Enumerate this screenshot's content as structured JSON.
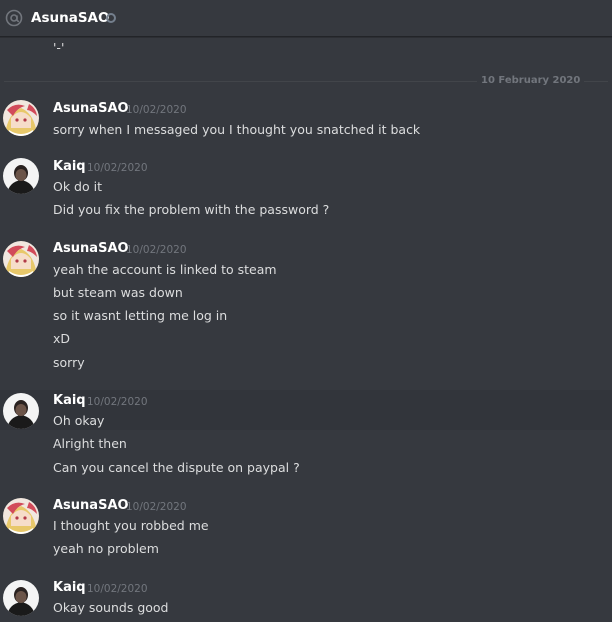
{
  "header": {
    "title": "AsunaSAO",
    "icon": "at-icon",
    "status_icon": "status-offline-icon"
  },
  "previous_message": {
    "text": "'-'"
  },
  "divider": {
    "label": "10 February 2020"
  },
  "groups": [
    {
      "author": "AsunaSAO",
      "timestamp": "10/02/2020",
      "avatar": "asuna-avatar",
      "lines": [
        "sorry when I messaged you I thought you snatched it back"
      ]
    },
    {
      "author": "Kaiq",
      "timestamp": "10/02/2020",
      "avatar": "kaiq-avatar",
      "lines": [
        "Ok do it",
        "Did you fix the problem with the password ?"
      ]
    },
    {
      "author": "AsunaSAO",
      "timestamp": "10/02/2020",
      "avatar": "asuna-avatar",
      "lines": [
        "yeah the account is linked to steam",
        "but steam was down",
        "so it wasnt letting me log in",
        "xD",
        "sorry"
      ]
    },
    {
      "author": "Kaiq",
      "timestamp": "10/02/2020",
      "avatar": "kaiq-avatar",
      "lines": [
        "Oh okay",
        "Alright then",
        "Can you cancel the dispute on paypal ?"
      ]
    },
    {
      "author": "AsunaSAO",
      "timestamp": "10/02/2020",
      "avatar": "asuna-avatar",
      "lines": [
        "I thought you robbed me",
        "yeah no problem"
      ]
    },
    {
      "author": "Kaiq",
      "timestamp": "10/02/2020",
      "avatar": "kaiq-avatar",
      "lines": [
        "Okay sounds good"
      ]
    }
  ],
  "colors": {
    "background": "#36393f",
    "text": "#dcddde",
    "muted": "#72767d",
    "author": "#ffffff"
  }
}
